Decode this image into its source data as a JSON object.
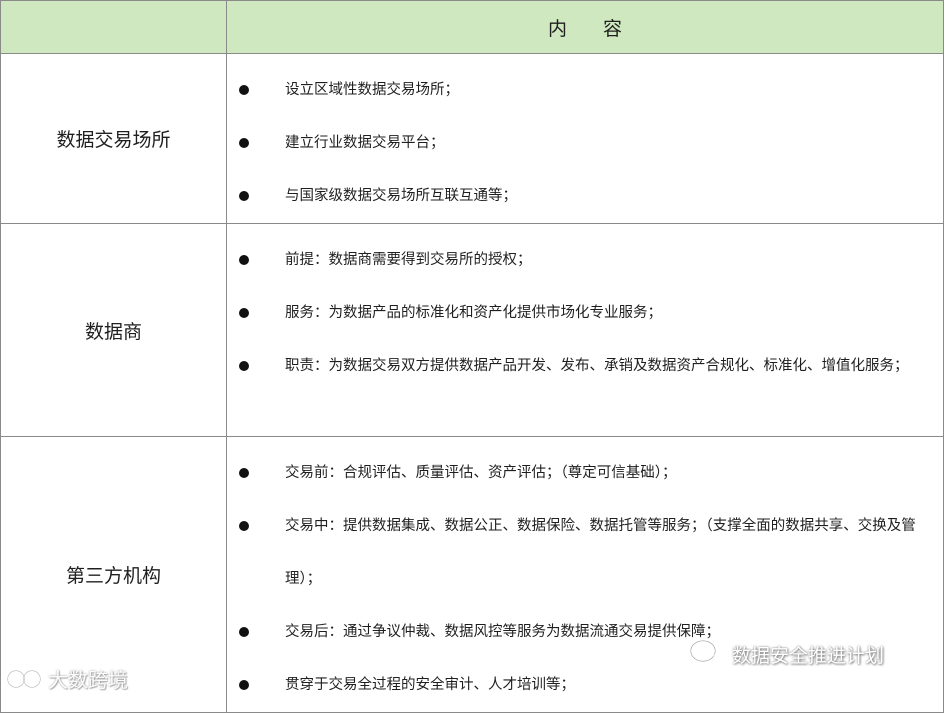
{
  "header": {
    "left": "",
    "right": "内容"
  },
  "rows": [
    {
      "category": "数据交易场所",
      "items": [
        "设立区域性数据交易场所；",
        "建立行业数据交易平台；",
        "与国家级数据交易场所互联互通等；"
      ]
    },
    {
      "category": "数据商",
      "items": [
        "前提：数据商需要得到交易所的授权；",
        "服务：为数据产品的标准化和资产化提供市场化专业服务；",
        "职责：为数据交易双方提供数据产品开发、发布、承销及数据资产合规化、标准化、增值化服务；"
      ]
    },
    {
      "category": "第三方机构",
      "items": [
        "交易前：合规评估、质量评估、资产评估；（尊定可信基础）；",
        "交易中：提供数据集成、数据公正、数据保险、数据托管等服务；（支撑全面的数据共享、交换及管理）；",
        "交易后：通过争议仲裁、数据风控等服务为数据流通交易提供保障；",
        "贯穿于交易全过程的安全审计、人才培训等；"
      ]
    }
  ],
  "watermarks": {
    "left": "大数跨境",
    "right": "数据安全推进计划",
    "left_icon": "logo-icon",
    "right_icon": "wechat-icon"
  },
  "colors": {
    "header_bg": "#cfe8bf",
    "border": "#8a8a8a"
  }
}
